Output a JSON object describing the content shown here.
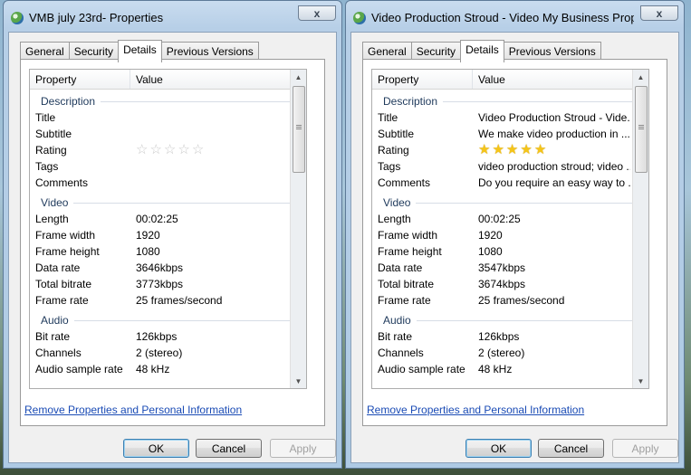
{
  "windows": [
    {
      "title": "VMB july 23rd- Properties",
      "close_label": "x",
      "tabs": [
        "General",
        "Security",
        "Details",
        "Previous Versions"
      ],
      "active_tab": "Details",
      "header": {
        "property": "Property",
        "value": "Value"
      },
      "sections": [
        {
          "label": "Description",
          "rows": [
            {
              "key": "Title",
              "value": ""
            },
            {
              "key": "Subtitle",
              "value": ""
            },
            {
              "key": "Rating",
              "value": "",
              "rating": 0,
              "rating_max": 5
            },
            {
              "key": "Tags",
              "value": ""
            },
            {
              "key": "Comments",
              "value": ""
            }
          ]
        },
        {
          "label": "Video",
          "rows": [
            {
              "key": "Length",
              "value": "00:02:25"
            },
            {
              "key": "Frame width",
              "value": "1920"
            },
            {
              "key": "Frame height",
              "value": "1080"
            },
            {
              "key": "Data rate",
              "value": "3646kbps"
            },
            {
              "key": "Total bitrate",
              "value": "3773kbps"
            },
            {
              "key": "Frame rate",
              "value": "25 frames/second"
            }
          ]
        },
        {
          "label": "Audio",
          "rows": [
            {
              "key": "Bit rate",
              "value": "126kbps"
            },
            {
              "key": "Channels",
              "value": "2 (stereo)"
            },
            {
              "key": "Audio sample rate",
              "value": "48 kHz"
            }
          ]
        }
      ],
      "remove_link": "Remove Properties and Personal Information",
      "buttons": {
        "ok": "OK",
        "cancel": "Cancel",
        "apply": "Apply"
      }
    },
    {
      "title": "Video Production Stroud - Video My Business Proper...",
      "close_label": "x",
      "tabs": [
        "General",
        "Security",
        "Details",
        "Previous Versions"
      ],
      "active_tab": "Details",
      "header": {
        "property": "Property",
        "value": "Value"
      },
      "sections": [
        {
          "label": "Description",
          "rows": [
            {
              "key": "Title",
              "value": "Video Production Stroud - Vide..."
            },
            {
              "key": "Subtitle",
              "value": "We make video production in ..."
            },
            {
              "key": "Rating",
              "value": "",
              "rating": 5,
              "rating_max": 5
            },
            {
              "key": "Tags",
              "value": "video production stroud; video ..."
            },
            {
              "key": "Comments",
              "value": "Do you require an easy way to ..."
            }
          ]
        },
        {
          "label": "Video",
          "rows": [
            {
              "key": "Length",
              "value": "00:02:25"
            },
            {
              "key": "Frame width",
              "value": "1920"
            },
            {
              "key": "Frame height",
              "value": "1080"
            },
            {
              "key": "Data rate",
              "value": "3547kbps"
            },
            {
              "key": "Total bitrate",
              "value": "3674kbps"
            },
            {
              "key": "Frame rate",
              "value": "25 frames/second"
            }
          ]
        },
        {
          "label": "Audio",
          "rows": [
            {
              "key": "Bit rate",
              "value": "126kbps"
            },
            {
              "key": "Channels",
              "value": "2 (stereo)"
            },
            {
              "key": "Audio sample rate",
              "value": "48 kHz"
            }
          ]
        }
      ],
      "remove_link": "Remove Properties and Personal Information",
      "buttons": {
        "ok": "OK",
        "cancel": "Cancel",
        "apply": "Apply"
      }
    }
  ]
}
